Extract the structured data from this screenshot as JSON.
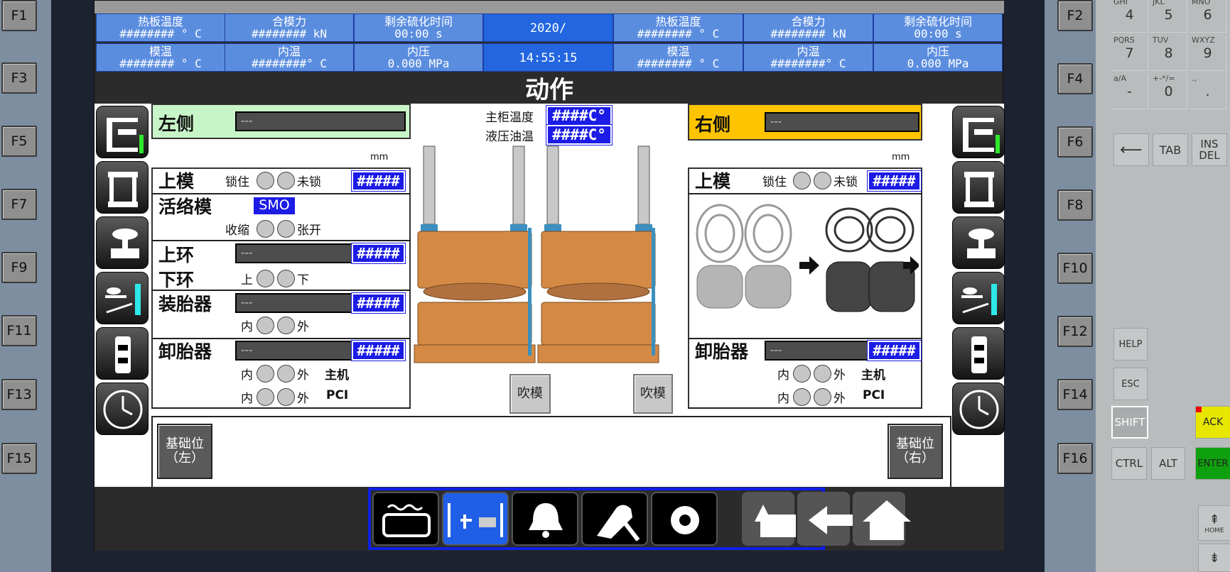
{
  "fkeys_left": [
    "F1",
    "F3",
    "F5",
    "F7",
    "F9",
    "F11",
    "F13",
    "F15"
  ],
  "fkeys_right": [
    "F2",
    "F4",
    "F6",
    "F8",
    "F10",
    "F12",
    "F14",
    "F16"
  ],
  "header": {
    "row1": [
      {
        "label": "热板温度",
        "value": "######## ° C"
      },
      {
        "label": "合模力",
        "value": "######## kN"
      },
      {
        "label": "剩余硫化时间",
        "value": "00:00 s"
      },
      {
        "label": "",
        "value": "2020/"
      },
      {
        "label": "热板温度",
        "value": "######## ° C"
      },
      {
        "label": "合模力",
        "value": "######## kN"
      },
      {
        "label": "剩余硫化时间",
        "value": "00:00 s"
      }
    ],
    "row2": [
      {
        "label": "模温",
        "value": "######## ° C"
      },
      {
        "label": "内温",
        "value": "########° C"
      },
      {
        "label": "内压",
        "value": "0.000 MPa"
      },
      {
        "label": "",
        "value": "14:55:15"
      },
      {
        "label": "模温",
        "value": "######## ° C"
      },
      {
        "label": "内温",
        "value": "########° C"
      },
      {
        "label": "内压",
        "value": "0.000 MPa"
      }
    ]
  },
  "title": "动作",
  "left": {
    "side": "左侧",
    "side_field": "---",
    "unit": "mm",
    "upper_mold": "上模",
    "lock": "锁住",
    "unlock": "未锁",
    "upper_mold_val": "#####",
    "live_mold": "活络模",
    "smo": "SMO",
    "shrink": "收缩",
    "open": "张开",
    "upper_ring": "上环",
    "upper_ring_field": "---",
    "upper_ring_val": "#####",
    "lower_ring": "下环",
    "up": "上",
    "down": "下",
    "loader": "装胎器",
    "loader_field": "---",
    "loader_val": "#####",
    "in": "内",
    "out": "外",
    "unloader": "卸胎器",
    "unloader_field": "---",
    "unloader_val": "#####",
    "main": "主机",
    "pci": "PCI"
  },
  "center": {
    "cabinet_temp_label": "主柜温度",
    "cabinet_temp": "####C°",
    "oil_temp_label": "液压油温",
    "oil_temp": "####C°",
    "blow_left": "吹模",
    "blow_right": "吹模"
  },
  "right": {
    "side": "右侧",
    "side_field": "---",
    "unit": "mm",
    "upper_mold": "上模",
    "lock": "锁住",
    "unlock": "未锁",
    "upper_mold_val": "#####",
    "unloader": "卸胎器",
    "unloader_field": "---",
    "unloader_val": "#####",
    "in": "内",
    "out": "外",
    "main": "主机",
    "pci": "PCI"
  },
  "base_left": "基础位\n（左）",
  "base_right": "基础位\n（右）",
  "keypad": {
    "keys": [
      {
        "sub": "GHI",
        "main": "4"
      },
      {
        "sub": "JKL",
        "main": "5"
      },
      {
        "sub": "MNO",
        "main": "6"
      },
      {
        "sub": "PQRS",
        "main": "7"
      },
      {
        "sub": "TUV",
        "main": "8"
      },
      {
        "sub": "WXYZ",
        "main": "9"
      },
      {
        "sub": "a/A",
        "main": "-"
      },
      {
        "sub": "+-*/=",
        "main": "0"
      },
      {
        "sub": ".,",
        "main": "."
      }
    ],
    "tab": "TAB",
    "ins": "INS",
    "del": "DEL",
    "help": "HELP",
    "esc": "ESC",
    "shift": "SHIFT",
    "ack": "ACK",
    "ctrl": "CTRL",
    "alt": "ALT",
    "enter": "ENTER",
    "home": "HOME"
  }
}
